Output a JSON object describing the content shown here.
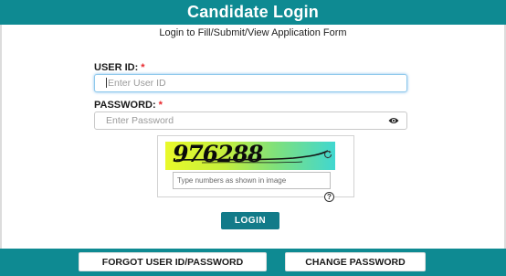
{
  "header": {
    "title": "Candidate Login"
  },
  "subtitle": "Login to Fill/Submit/View Application Form",
  "form": {
    "user_id_label": "USER ID:",
    "user_id_required": "*",
    "user_id_placeholder": "Enter User ID",
    "password_label": "PASSWORD:",
    "password_required": "*",
    "password_placeholder": "Enter Password",
    "captcha_text": "976288",
    "captcha_placeholder": "Type numbers as shown in image",
    "help_symbol": "?",
    "login_label": "LOGIN"
  },
  "footer": {
    "forgot_label": "FORGOT USER ID/PASSWORD",
    "change_label": "CHANGE PASSWORD"
  },
  "colors": {
    "primary": "#0e8a92",
    "button": "#127b89",
    "required": "#e8262b"
  },
  "icons": [
    "eye-icon",
    "refresh-icon",
    "help-icon"
  ]
}
